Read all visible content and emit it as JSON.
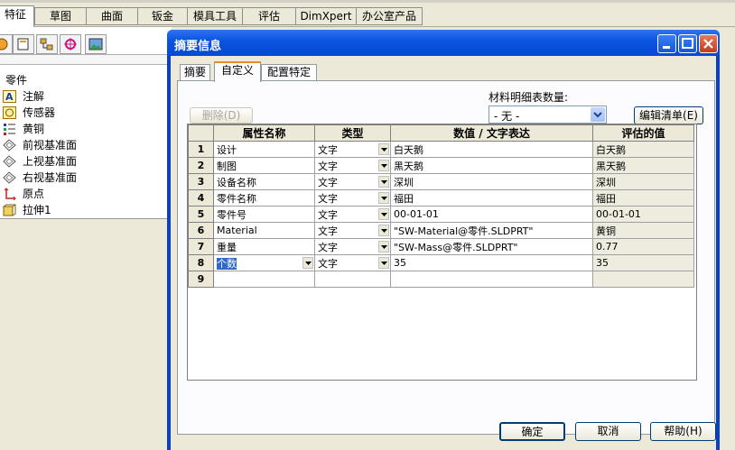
{
  "top_tabs": [
    "特征",
    "草图",
    "曲面",
    "钣金",
    "模具工具",
    "评估",
    "DimXpert",
    "办公室产品"
  ],
  "active_tab": "特征",
  "tree": {
    "root": "零件",
    "items": [
      {
        "label": "注解",
        "icon": "annotation-icon"
      },
      {
        "label": "传感器",
        "icon": "sensor-icon"
      },
      {
        "label": "黄铜",
        "icon": "material-icon"
      },
      {
        "label": "前视基准面",
        "icon": "plane-icon"
      },
      {
        "label": "上视基准面",
        "icon": "plane-icon"
      },
      {
        "label": "右视基准面",
        "icon": "plane-icon"
      },
      {
        "label": "原点",
        "icon": "origin-icon"
      },
      {
        "label": "拉伸1",
        "icon": "extrude-icon"
      }
    ]
  },
  "dialog": {
    "title": "摘要信息",
    "tabs": [
      "摘要",
      "自定义",
      "配置特定"
    ],
    "active_tab": "自定义",
    "delete_button": "删除(D)",
    "bom_qty_label": "材料明细表数量:",
    "bom_qty_value": "- 无 -",
    "edit_list_button": "编辑清单(E)",
    "columns": [
      "属性名称",
      "类型",
      "数值 / 文字表达",
      "评估的值"
    ],
    "rows": [
      {
        "n": "1",
        "name": "设计",
        "type": "文字",
        "value": "白天鹅",
        "evaluated": "白天鹅"
      },
      {
        "n": "2",
        "name": "制图",
        "type": "文字",
        "value": "黑天鹅",
        "evaluated": "黑天鹅"
      },
      {
        "n": "3",
        "name": "设备名称",
        "type": "文字",
        "value": "深圳",
        "evaluated": "深圳"
      },
      {
        "n": "4",
        "name": "零件名称",
        "type": "文字",
        "value": "福田",
        "evaluated": "福田"
      },
      {
        "n": "5",
        "name": "零件号",
        "type": "文字",
        "value": "00-01-01",
        "evaluated": "00-01-01"
      },
      {
        "n": "6",
        "name": "Material",
        "type": "文字",
        "value": "\"SW-Material@零件.SLDPRT\"",
        "evaluated": "黄铜"
      },
      {
        "n": "7",
        "name": "重量",
        "type": "文字",
        "value": "\"SW-Mass@零件.SLDPRT\"",
        "evaluated": "0.77"
      },
      {
        "n": "8",
        "name": "个数",
        "type": "文字",
        "value": "35",
        "evaluated": "35"
      },
      {
        "n": "9",
        "name": "",
        "type": "",
        "value": "",
        "evaluated": ""
      }
    ],
    "ok_button": "确定",
    "cancel_button": "取消",
    "help_button": "帮助(H)"
  },
  "colors": {
    "title_bar": "#0a55e0",
    "window_bg": "#ece9d8",
    "active_tab_accent": "#e68b2c",
    "selection": "#316ac5"
  }
}
